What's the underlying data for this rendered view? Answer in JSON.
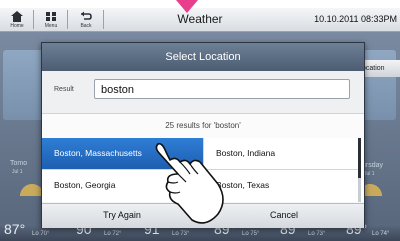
{
  "topbar": {
    "home_label": "Home",
    "menu_label": "Menu",
    "back_label": "Back",
    "title": "Weather",
    "datetime": "10.10.2011 08:33PM"
  },
  "background": {
    "location_button": "ocation",
    "day_left": "Tomo",
    "day_left_sub": "Jul 1",
    "day_right": "ursday",
    "day_right_sub": "Jul 1",
    "temps": [
      "87°",
      "90°",
      "91°",
      "89°",
      "89°",
      "89°"
    ],
    "lows": [
      "Lo 70°",
      "Lo 72°",
      "Lo 73°",
      "Lo 75°",
      "Lo 73°",
      "Lo 74°"
    ]
  },
  "dialog": {
    "title": "Select Location",
    "result_label": "Result",
    "search_value": "boston",
    "results_count": "25 results for 'boston'",
    "items": [
      {
        "label": "Boston, Massachusetts",
        "selected": true
      },
      {
        "label": "Boston, Indiana",
        "selected": false
      },
      {
        "label": "Boston, Georgia",
        "selected": false
      },
      {
        "label": "Boston, Texas",
        "selected": false
      }
    ],
    "try_again_label": "Try Again",
    "cancel_label": "Cancel"
  },
  "colors": {
    "selection": "#2f7ed6",
    "title_bar": "#5b6c82",
    "pink_marker": "#e83e8c"
  }
}
